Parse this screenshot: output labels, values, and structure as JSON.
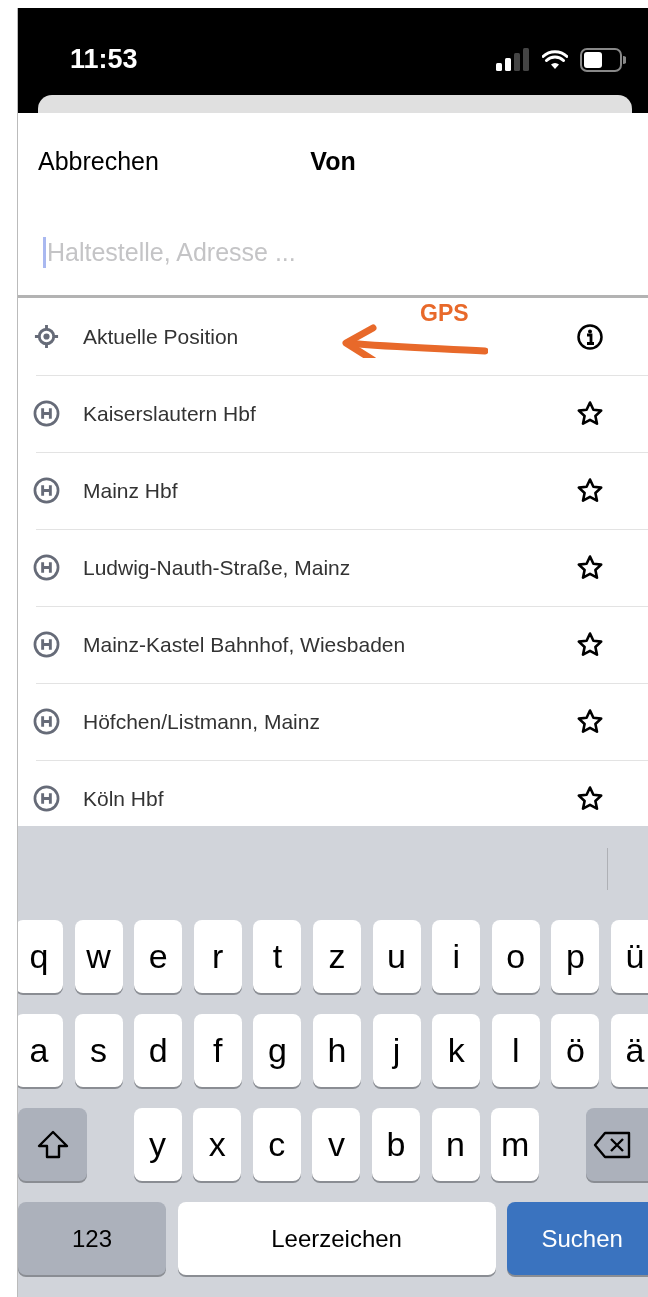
{
  "status_bar": {
    "time": "11:53"
  },
  "header": {
    "cancel": "Abbrechen",
    "title": "Von"
  },
  "search": {
    "placeholder": "Haltestelle, Adresse ..."
  },
  "results": [
    {
      "kind": "location",
      "label": "Aktuelle Position",
      "button": {
        "kind": "info"
      }
    },
    {
      "kind": "stop",
      "label": "Kaiserslautern Hbf",
      "button": {
        "kind": "star"
      }
    },
    {
      "kind": "stop",
      "label": "Mainz Hbf",
      "button": {
        "kind": "star"
      }
    },
    {
      "kind": "stop",
      "label": "Ludwig-Nauth-Straße, Mainz",
      "button": {
        "kind": "star"
      }
    },
    {
      "kind": "stop",
      "label": "Mainz-Kastel Bahnhof, Wiesbaden",
      "button": {
        "kind": "star"
      }
    },
    {
      "kind": "stop",
      "label": "Höfchen/Listmann, Mainz",
      "button": {
        "kind": "star"
      }
    },
    {
      "kind": "stop",
      "label": "Köln Hbf",
      "button": {
        "kind": "star"
      }
    }
  ],
  "annotation": {
    "label": "GPS"
  },
  "keyboard": {
    "rows": [
      {
        "keys": [
          {
            "kind": "char",
            "label": "q"
          },
          {
            "kind": "char",
            "label": "w"
          },
          {
            "kind": "char",
            "label": "e"
          },
          {
            "kind": "char",
            "label": "r"
          },
          {
            "kind": "char",
            "label": "t"
          },
          {
            "kind": "char",
            "label": "z"
          },
          {
            "kind": "char",
            "label": "u"
          },
          {
            "kind": "char",
            "label": "i"
          },
          {
            "kind": "char",
            "label": "o"
          },
          {
            "kind": "char",
            "label": "p"
          },
          {
            "kind": "char",
            "label": "ü"
          }
        ]
      },
      {
        "keys": [
          {
            "kind": "char",
            "label": "a"
          },
          {
            "kind": "char",
            "label": "s"
          },
          {
            "kind": "char",
            "label": "d"
          },
          {
            "kind": "char",
            "label": "f"
          },
          {
            "kind": "char",
            "label": "g"
          },
          {
            "kind": "char",
            "label": "h"
          },
          {
            "kind": "char",
            "label": "j"
          },
          {
            "kind": "char",
            "label": "k"
          },
          {
            "kind": "char",
            "label": "l"
          },
          {
            "kind": "char",
            "label": "ö"
          },
          {
            "kind": "char",
            "label": "ä"
          }
        ]
      },
      {
        "keys": [
          {
            "kind": "shift"
          },
          {
            "kind": "char",
            "label": "y"
          },
          {
            "kind": "char",
            "label": "x"
          },
          {
            "kind": "char",
            "label": "c"
          },
          {
            "kind": "char",
            "label": "v"
          },
          {
            "kind": "char",
            "label": "b"
          },
          {
            "kind": "char",
            "label": "n"
          },
          {
            "kind": "char",
            "label": "m"
          },
          {
            "kind": "backspace"
          }
        ]
      },
      {
        "keys": [
          {
            "kind": "mode",
            "label": "123"
          },
          {
            "kind": "space",
            "label": "Leerzeichen"
          },
          {
            "kind": "action",
            "label": "Suchen"
          }
        ]
      }
    ]
  }
}
